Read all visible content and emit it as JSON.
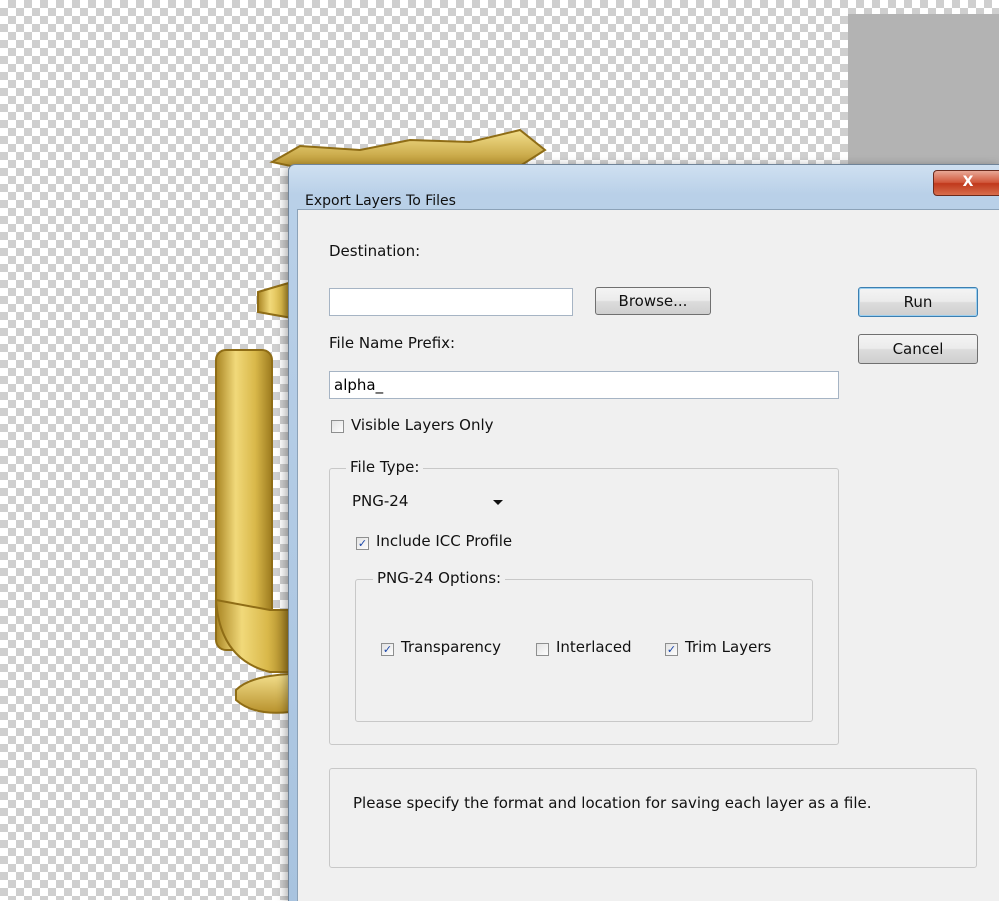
{
  "dialog": {
    "title": "Export Layers To Files",
    "close_label": "X",
    "destination_label": "Destination:",
    "destination_value": "",
    "browse_label": "Browse...",
    "run_label": "Run",
    "cancel_label": "Cancel",
    "prefix_label": "File Name Prefix:",
    "prefix_value": "alpha_",
    "visible_layers_only": {
      "label": "Visible Layers Only",
      "checked": false
    },
    "file_type": {
      "group_label": "File Type:",
      "selected": "PNG-24",
      "include_icc": {
        "label": "Include ICC Profile",
        "checked": true
      }
    },
    "png_options": {
      "group_label": "PNG-24 Options:",
      "transparency": {
        "label": "Transparency",
        "checked": true
      },
      "interlaced": {
        "label": "Interlaced",
        "checked": false
      },
      "trim_layers": {
        "label": "Trim Layers",
        "checked": true
      }
    },
    "message": "Please specify the format and location for saving each layer as a file."
  },
  "colors": {
    "title_bar": "#b9d0e8",
    "close_button": "#c9452a",
    "artwork_gold": "#d9b84a"
  },
  "icons": {
    "close": "close-icon",
    "dropdown": "chevron-down-icon",
    "check": "checkmark-icon"
  }
}
